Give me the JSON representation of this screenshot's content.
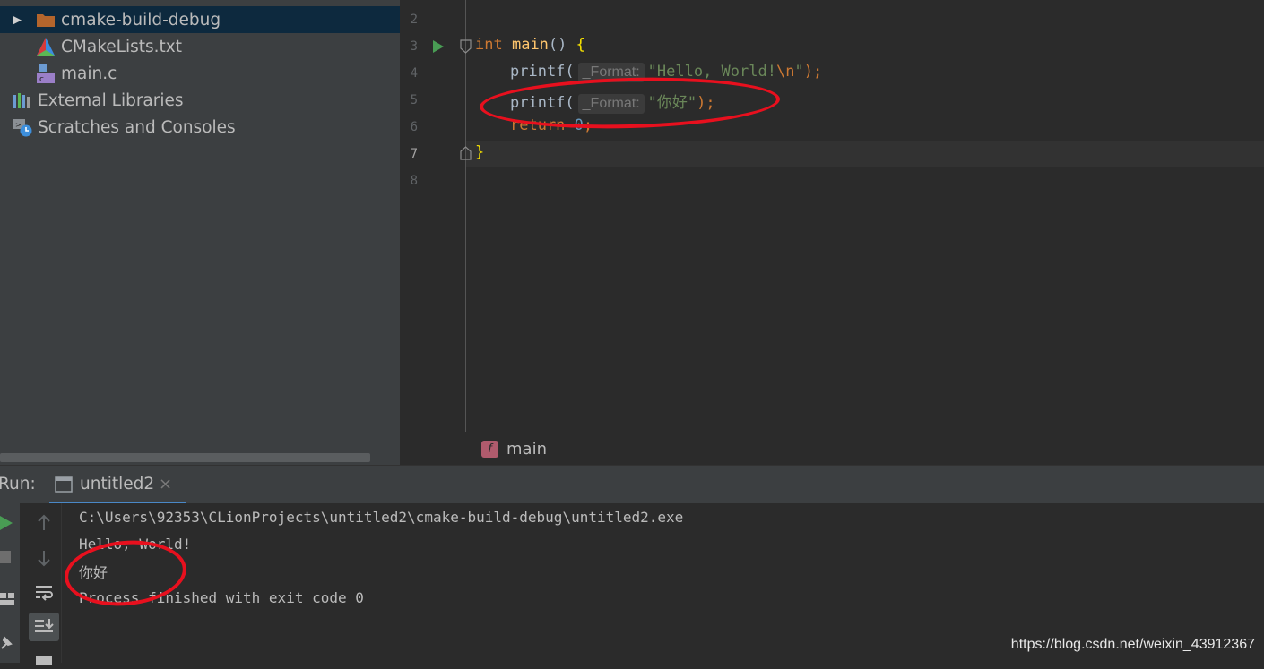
{
  "project_tree": [
    {
      "label": "cmake-build-debug",
      "type": "folder",
      "expanded": false,
      "selected": true
    },
    {
      "label": "CMakeLists.txt",
      "type": "cmake-file"
    },
    {
      "label": "main.c",
      "type": "c-file"
    },
    {
      "label": "External Libraries",
      "type": "libraries"
    },
    {
      "label": "Scratches and Consoles",
      "type": "scratches"
    }
  ],
  "editor": {
    "line_numbers": [
      "2",
      "3",
      "4",
      "5",
      "6",
      "7",
      "8"
    ],
    "lines": {
      "l3": {
        "kw": "int",
        "fn": "main",
        "rest": "() ",
        "brace": "{"
      },
      "l4": {
        "call": "printf(",
        "hint": "_Format:",
        "str": "\"Hello, World!",
        "esc": "\\n",
        "str_end": "\"",
        "tail": ");"
      },
      "l5": {
        "call": "printf(",
        "hint": "_Format:",
        "str": "\"你好\"",
        "tail": ");"
      },
      "l6": {
        "kw": "return",
        "num": "0",
        "tail": ";"
      },
      "l7": {
        "brace": "}"
      }
    },
    "breadcrumb": {
      "badge": "f",
      "label": "main"
    }
  },
  "run": {
    "label": "Run:",
    "tab": "untitled2",
    "close": "×",
    "console": [
      "C:\\Users\\92353\\CLionProjects\\untitled2\\cmake-build-debug\\untitled2.exe",
      "Hello, World!",
      "你好",
      "Process finished with exit code 0"
    ]
  },
  "watermark": "https://blog.csdn.net/weixin_43912367",
  "colors": {
    "annotation": "#e8101e",
    "selection": "#0d293e",
    "run_icon": "#499c54"
  }
}
